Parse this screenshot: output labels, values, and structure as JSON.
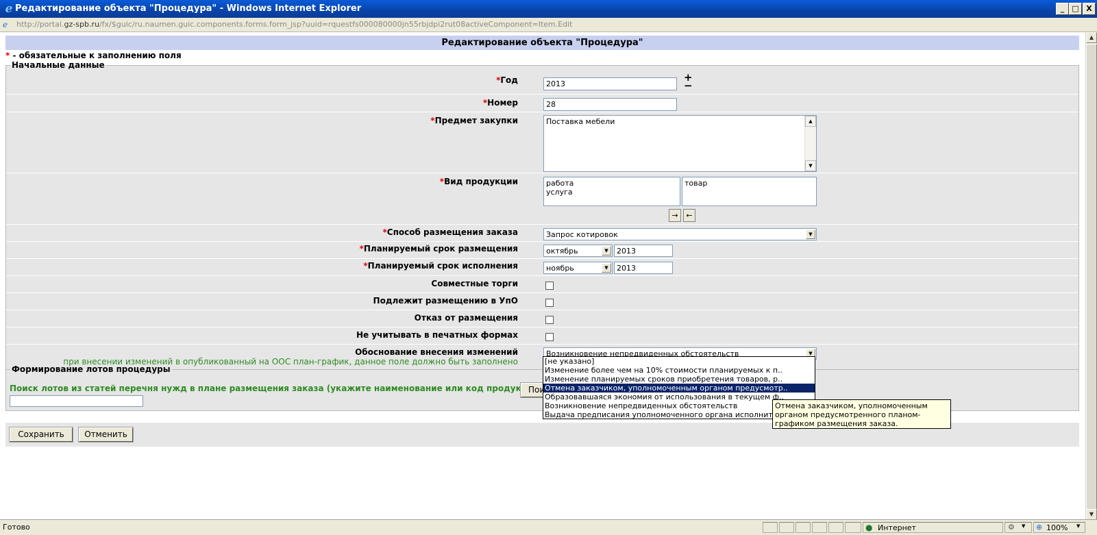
{
  "window": {
    "title": "Редактирование объекта \"Процедура\" - Windows Internet Explorer",
    "buttons": {
      "minimize": "_",
      "maximize": "□",
      "close": "X"
    }
  },
  "address": {
    "prefix": "http://portal.",
    "domain": "gz-spb.ru",
    "path": "/fx/$guic/ru.naumen.guic.components.forms.form_jsp?uuid=rquestfs000080000jn55rbjdpi2rut08activeComponent=Item.Edit"
  },
  "form": {
    "title": "Редактирование объекта \"Процедура\"",
    "required_star": "*",
    "required_note": " - обязательные к заполнению поля",
    "section1": {
      "legend": "Начальные данные",
      "year": {
        "label": "Год",
        "value": "2013",
        "plus": "+",
        "minus": "−"
      },
      "number": {
        "label": "Номер",
        "value": "28"
      },
      "subject": {
        "label": "Предмет закупки",
        "value": "Поставка мебели"
      },
      "product_type": {
        "label": "Вид продукции",
        "available": [
          "работа",
          "услуга"
        ],
        "selected": [
          "товар"
        ],
        "move_right": "→",
        "move_left": "←"
      },
      "method": {
        "label": "Способ размещения заказа",
        "value": "Запрос котировок"
      },
      "placement_term": {
        "label": "Планируемый срок размещения",
        "month": "октябрь",
        "year": "2013"
      },
      "execution_term": {
        "label": "Планируемый срок исполнения",
        "month": "ноябрь",
        "year": "2013"
      },
      "joint_tenders": {
        "label": "Совместные торги"
      },
      "upo_placement": {
        "label": "Подлежит размещению в УпО"
      },
      "placement_refusal": {
        "label": "Отказ от размещения"
      },
      "ignore_print": {
        "label": "Не учитывать в печатных формах"
      },
      "change_reason": {
        "label": "Обоснование внесения изменений",
        "value": "Возникновение непредвиденных обстоятельств",
        "note": "при внесении изменений в опубликованный на ООС план-график, данное поле должно быть заполнено",
        "options": [
          "[не указано]",
          "Изменение более чем на 10% стоимости планируемых к п..",
          "Изменение планируемых сроков приобретения товаров, р..",
          "Отмена заказчиком, уполномоченным органом предусмотр..",
          "Образовавшаяся экономия от использования в текущем ф..",
          "Возникновение непредвиденных обстоятельств",
          "Выдача предписания уполномоченного органа исполнит.."
        ],
        "highlighted_index": 3,
        "tooltip": "Отмена заказчиком, уполномоченным органом предусмотренного планом-графиком размещения заказа."
      }
    },
    "section2": {
      "legend": "Формирование лотов процедуры",
      "search_label": "Поиск лотов из статей перечня нужд в плане размещения заказа (укажите наименование или код продукции)",
      "search_value": "",
      "search_button": "Поиск"
    },
    "save_button": "Сохранить",
    "cancel_button": "Отменить"
  },
  "status": {
    "text": "Готово",
    "zone": "Интернет",
    "zoom": "100%"
  },
  "colors": {
    "titlebar": "#0843a8",
    "form_header": "#c8d0f0",
    "required": "#e00000",
    "note_green": "#2e8b22",
    "selection": "#0a246a",
    "tooltip_bg": "#ffffe1"
  }
}
